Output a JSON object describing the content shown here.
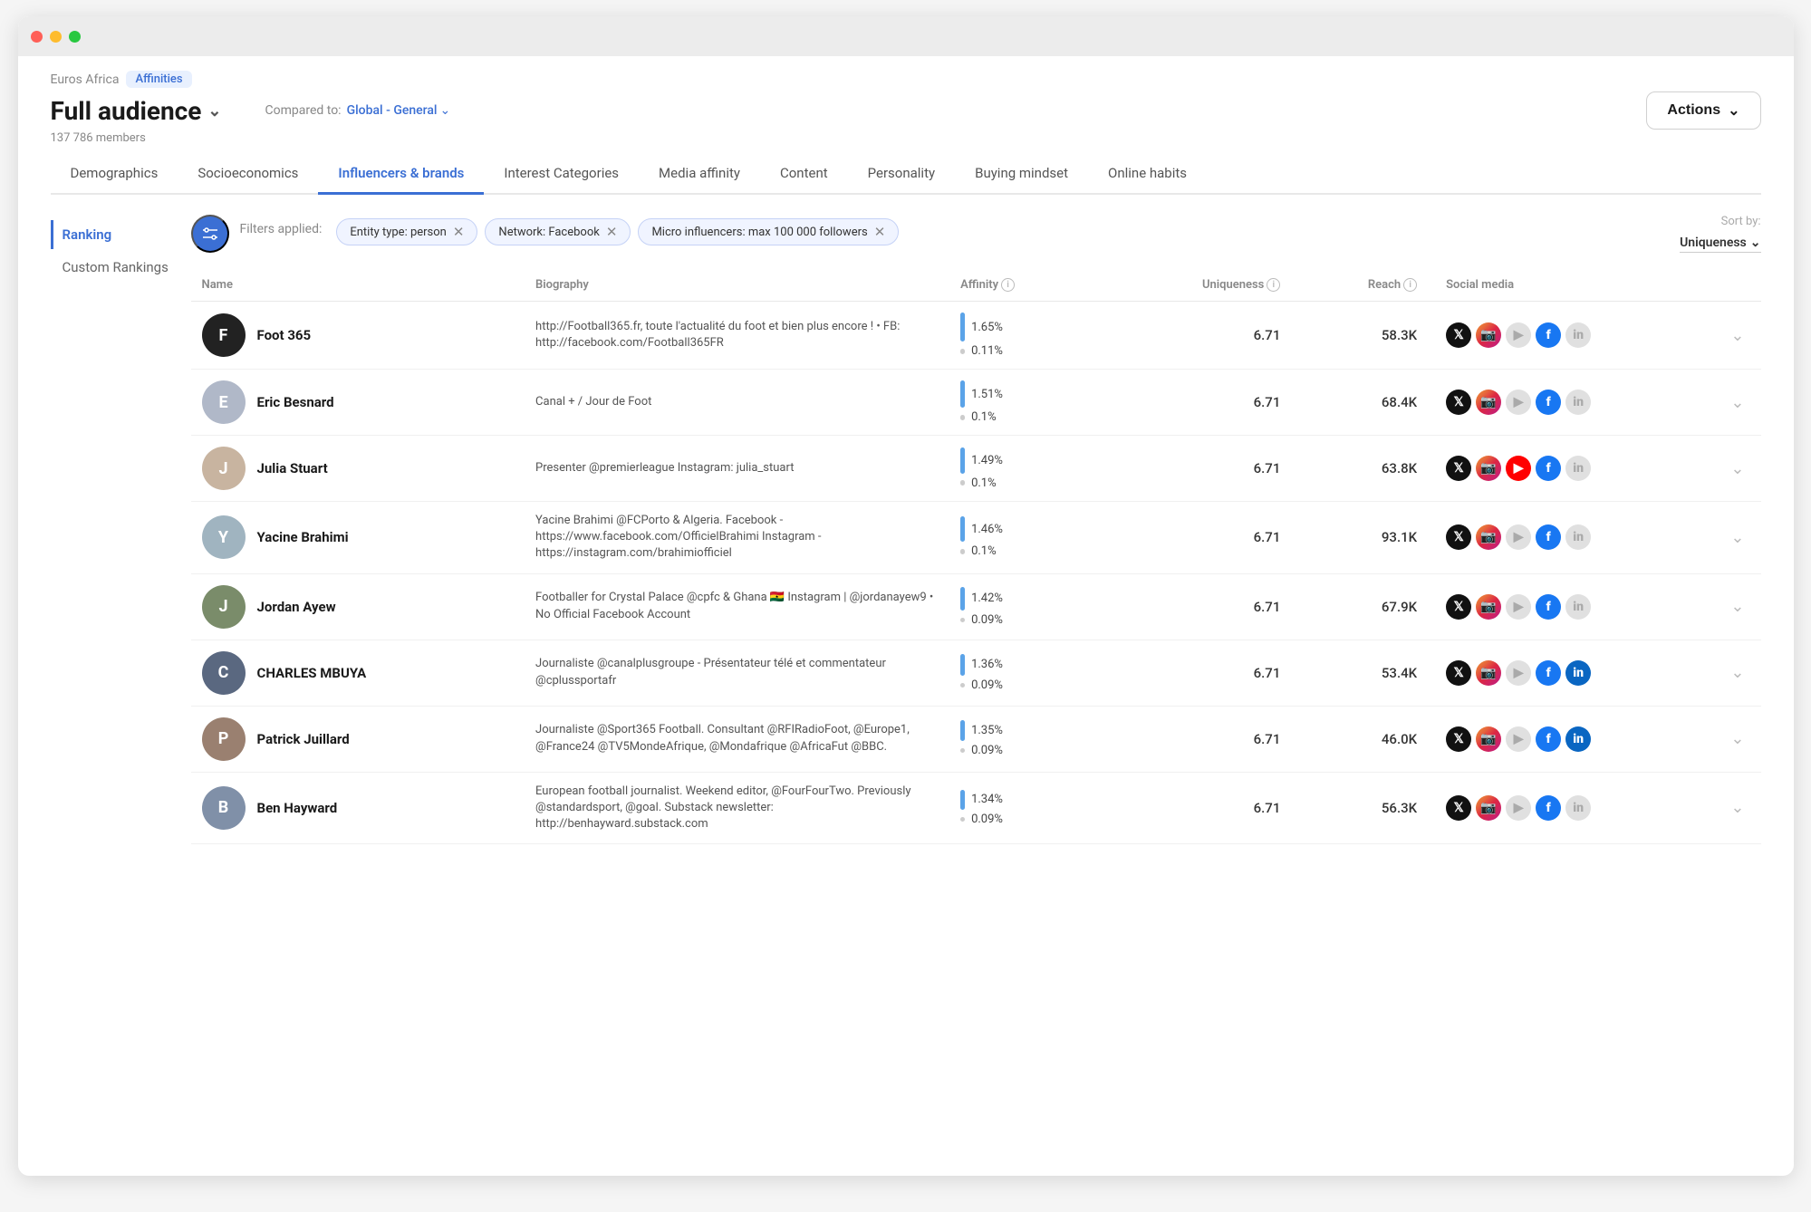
{
  "window": {
    "title": "Euros Africa - Affinities"
  },
  "breadcrumb": {
    "app": "Euros Africa",
    "badge": "Affinities"
  },
  "header": {
    "audience_label": "Full audience",
    "compared_to_label": "Compared to:",
    "compared_to_value": "Global - General",
    "members_count": "137 786 members",
    "actions_label": "Actions"
  },
  "tabs": [
    {
      "id": "demographics",
      "label": "Demographics",
      "active": false
    },
    {
      "id": "socioeconomics",
      "label": "Socioeconomics",
      "active": false
    },
    {
      "id": "influencers",
      "label": "Influencers & brands",
      "active": true
    },
    {
      "id": "interest-categories",
      "label": "Interest Categories",
      "active": false
    },
    {
      "id": "media-affinity",
      "label": "Media affinity",
      "active": false
    },
    {
      "id": "content",
      "label": "Content",
      "active": false
    },
    {
      "id": "personality",
      "label": "Personality",
      "active": false
    },
    {
      "id": "buying-mindset",
      "label": "Buying mindset",
      "active": false
    },
    {
      "id": "online-habits",
      "label": "Online habits",
      "active": false
    }
  ],
  "sidebar": {
    "items": [
      {
        "id": "ranking",
        "label": "Ranking",
        "active": true
      },
      {
        "id": "custom-rankings",
        "label": "Custom Rankings",
        "active": false
      }
    ]
  },
  "filters": {
    "applied_label": "Filters applied:",
    "items": [
      {
        "id": "entity-type",
        "label": "Entity type: person"
      },
      {
        "id": "network",
        "label": "Network: Facebook"
      },
      {
        "id": "micro-influencers",
        "label": "Micro influencers: max 100 000 followers"
      }
    ]
  },
  "sort": {
    "label": "Sort by:",
    "value": "Uniqueness"
  },
  "table": {
    "columns": [
      {
        "id": "name",
        "label": "Name"
      },
      {
        "id": "biography",
        "label": "Biography"
      },
      {
        "id": "affinity",
        "label": "Affinity",
        "has_info": true
      },
      {
        "id": "uniqueness",
        "label": "Uniqueness",
        "has_info": true
      },
      {
        "id": "reach",
        "label": "Reach",
        "has_info": true
      },
      {
        "id": "social_media",
        "label": "Social media"
      }
    ],
    "rows": [
      {
        "id": 1,
        "name": "Foot 365",
        "avatar_label": "F",
        "avatar_class": "avatar-foot365",
        "biography": "http://Football365.fr, toute l'actualité du foot et bien plus encore ! • FB: http://facebook.com/Football365FR",
        "affinity_high": "1.65%",
        "affinity_low": "0.11%",
        "affinity_high_height": 32,
        "affinity_low_height": 6,
        "uniqueness": "6.71",
        "reach": "58.3K",
        "socials": [
          "x",
          "ig",
          "yt-gray",
          "fb",
          "li-gray"
        ]
      },
      {
        "id": 2,
        "name": "Eric Besnard",
        "avatar_label": "E",
        "avatar_class": "avatar-eric",
        "biography": "Canal + / Jour de Foot",
        "affinity_high": "1.51%",
        "affinity_low": "0.1%",
        "affinity_high_height": 30,
        "affinity_low_height": 6,
        "uniqueness": "6.71",
        "reach": "68.4K",
        "socials": [
          "x",
          "ig",
          "yt-gray",
          "fb",
          "li-gray"
        ]
      },
      {
        "id": 3,
        "name": "Julia Stuart",
        "avatar_label": "J",
        "avatar_class": "avatar-julia",
        "biography": "Presenter @premierleague Instagram: julia_stuart",
        "affinity_high": "1.49%",
        "affinity_low": "0.1%",
        "affinity_high_height": 29,
        "affinity_low_height": 6,
        "uniqueness": "6.71",
        "reach": "63.8K",
        "socials": [
          "x",
          "ig",
          "yt",
          "fb",
          "li-gray"
        ]
      },
      {
        "id": 4,
        "name": "Yacine Brahimi",
        "avatar_label": "Y",
        "avatar_class": "avatar-yacine",
        "biography": "Yacine Brahimi @FCPorto & Algeria. Facebook - https://www.facebook.com/OfficielBrahimi Instagram - https://instagram.com/brahimiofficiel",
        "affinity_high": "1.46%",
        "affinity_low": "0.1%",
        "affinity_high_height": 28,
        "affinity_low_height": 6,
        "uniqueness": "6.71",
        "reach": "93.1K",
        "socials": [
          "x",
          "ig",
          "yt-gray",
          "fb",
          "li-gray"
        ]
      },
      {
        "id": 5,
        "name": "Jordan Ayew",
        "avatar_label": "J",
        "avatar_class": "avatar-jordan",
        "biography": "Footballer for Crystal Palace @cpfc & Ghana 🇬🇭 Instagram | @jordanayew9 • No Official Facebook Account",
        "affinity_high": "1.42%",
        "affinity_low": "0.09%",
        "affinity_high_height": 26,
        "affinity_low_height": 5,
        "uniqueness": "6.71",
        "reach": "67.9K",
        "socials": [
          "x",
          "ig",
          "yt-gray",
          "fb",
          "li-gray"
        ]
      },
      {
        "id": 6,
        "name": "CHARLES MBUYA",
        "avatar_label": "C",
        "avatar_class": "avatar-charles",
        "biography": "Journaliste @canalplusgroupe - Présentateur télé et commentateur @cplussportafr",
        "affinity_high": "1.36%",
        "affinity_low": "0.09%",
        "affinity_high_height": 24,
        "affinity_low_height": 5,
        "uniqueness": "6.71",
        "reach": "53.4K",
        "socials": [
          "x",
          "ig",
          "yt-gray",
          "fb",
          "li"
        ]
      },
      {
        "id": 7,
        "name": "Patrick Juillard",
        "avatar_label": "P",
        "avatar_class": "avatar-patrick",
        "biography": "Journaliste @Sport365 Football. Consultant @RFIRadioFoot, @Europe1, @France24 @TV5MondeAfrique, @Mondafrique @AfricaFut @BBC.",
        "affinity_high": "1.35%",
        "affinity_low": "0.09%",
        "affinity_high_height": 23,
        "affinity_low_height": 5,
        "uniqueness": "6.71",
        "reach": "46.0K",
        "socials": [
          "x",
          "ig",
          "yt-gray",
          "fb",
          "li"
        ]
      },
      {
        "id": 8,
        "name": "Ben Hayward",
        "avatar_label": "B",
        "avatar_class": "avatar-ben",
        "biography": "European football journalist. Weekend editor, @FourFourTwo. Previously @standardsport, @goal. Substack newsletter: http://benhayward.substack.com",
        "affinity_high": "1.34%",
        "affinity_low": "0.09%",
        "affinity_high_height": 22,
        "affinity_low_height": 5,
        "uniqueness": "6.71",
        "reach": "56.3K",
        "socials": [
          "x",
          "ig",
          "yt-gray",
          "fb",
          "li-gray"
        ]
      }
    ]
  }
}
